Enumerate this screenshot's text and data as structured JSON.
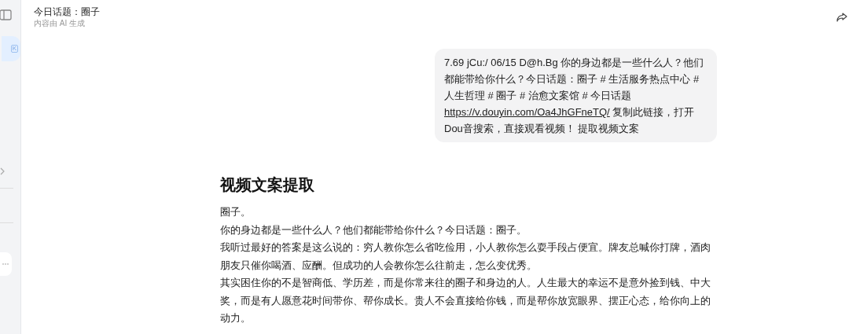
{
  "sidebar": {
    "shortcut_key": "K"
  },
  "header": {
    "title": "今日话题：圈子",
    "subtitle": "内容由 AI 生成"
  },
  "message": {
    "before": "7.69 jCu:/ 06/15 D@h.Bg 你的身边都是一些什么人？他们都能带给你什么？今日话题：圈子 # 生活服务热点中心 # 人生哲理 # 圈子 # 治愈文案馆 # 今日话题 ",
    "link": "https://v.douyin.com/Oa4JhGFneTQ/",
    "after": " 复制此链接，打开Dou音搜索，直接观看视频！ 提取视频文案"
  },
  "answer": {
    "heading": "视频文案提取",
    "paragraphs": [
      "圈子。",
      "你的身边都是一些什么人？他们都能带给你什么？今日话题：圈子。",
      "我听过最好的答案是这么说的：穷人教你怎么省吃俭用，小人教你怎么耍手段占便宜。牌友总喊你打牌，酒肉朋友只催你喝酒、应酬。但成功的人会教你怎么往前走，怎么变优秀。",
      "其实困住你的不是智商低、学历差，而是你常来往的圈子和身边的人。人生最大的幸运不是意外捡到钱、中大奖，而是有人愿意花时间带你、帮你成长。贵人不会直接给你钱，而是帮你放宽眼界、摆正心态，给你向上的动力。"
    ]
  }
}
